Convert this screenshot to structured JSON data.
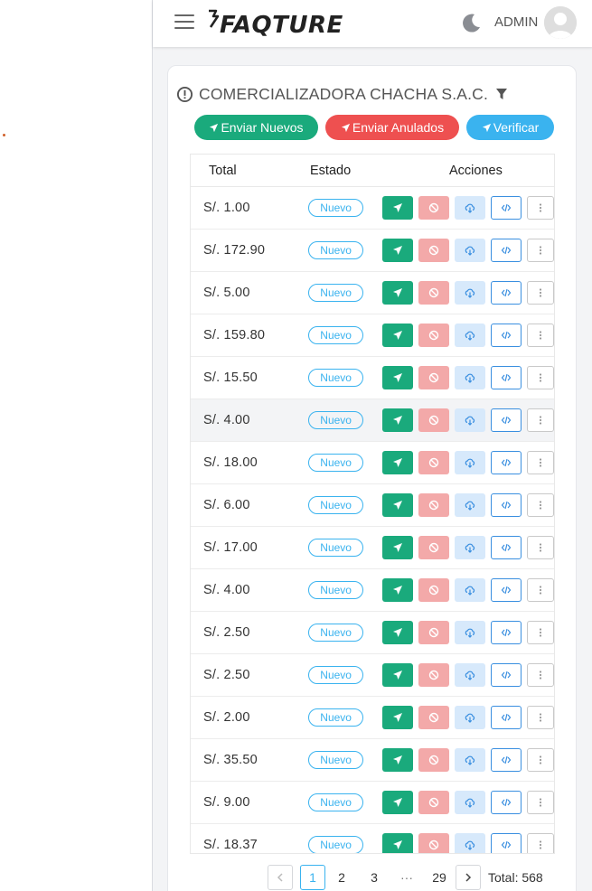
{
  "header": {
    "logo": "FAQTURE",
    "user": "ADMIN",
    "icons": {
      "menu": "hamburger-icon",
      "theme": "moon-icon",
      "avatar": "user-avatar-icon"
    }
  },
  "card": {
    "company": "COMERCIALIZADORA CHACHA S.A.C.",
    "buttons": {
      "enviar_nuevos": "Enviar Nuevos",
      "enviar_anulados": "Enviar Anulados",
      "verificar": "Verificar"
    }
  },
  "table": {
    "columns": [
      "Total",
      "Estado",
      "Acciones"
    ],
    "rows": [
      {
        "total": "S/. 1.00",
        "estado": "Nuevo"
      },
      {
        "total": "S/. 172.90",
        "estado": "Nuevo"
      },
      {
        "total": "S/. 5.00",
        "estado": "Nuevo"
      },
      {
        "total": "S/. 159.80",
        "estado": "Nuevo"
      },
      {
        "total": "S/. 15.50",
        "estado": "Nuevo"
      },
      {
        "total": "S/. 4.00",
        "estado": "Nuevo"
      },
      {
        "total": "S/. 18.00",
        "estado": "Nuevo"
      },
      {
        "total": "S/. 6.00",
        "estado": "Nuevo"
      },
      {
        "total": "S/. 17.00",
        "estado": "Nuevo"
      },
      {
        "total": "S/. 4.00",
        "estado": "Nuevo"
      },
      {
        "total": "S/. 2.50",
        "estado": "Nuevo"
      },
      {
        "total": "S/. 2.50",
        "estado": "Nuevo"
      },
      {
        "total": "S/. 2.00",
        "estado": "Nuevo"
      },
      {
        "total": "S/. 35.50",
        "estado": "Nuevo"
      },
      {
        "total": "S/. 9.00",
        "estado": "Nuevo"
      },
      {
        "total": "S/. 18.37",
        "estado": "Nuevo"
      }
    ],
    "hover_row": 5
  },
  "pagination": {
    "pages": [
      "1",
      "2",
      "3"
    ],
    "ellipsis": "···",
    "last": "29",
    "current": "1",
    "total_label": "Total: 568"
  },
  "colors": {
    "green": "#1aaa7c",
    "red": "#ee5050",
    "blue": "#3ab3ef"
  }
}
